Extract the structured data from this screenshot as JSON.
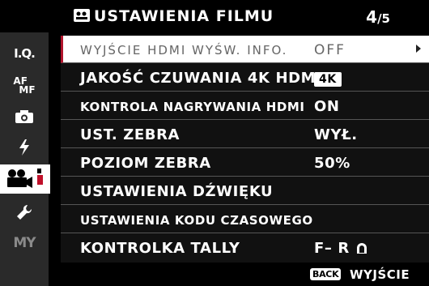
{
  "header": {
    "icon": "movie-camera-icon",
    "title": "USTAWIENIA FILMU",
    "page": "4",
    "page_total": "/5"
  },
  "sidebar": {
    "items": [
      {
        "label": "I.Q.",
        "icon": "image-quality-icon"
      },
      {
        "label_top": "AF",
        "label_bottom": "MF",
        "icon": "af-mf-icon"
      },
      {
        "icon": "camera-icon"
      },
      {
        "icon": "flash-icon"
      },
      {
        "icon": "movie-camera-icon",
        "active": true
      },
      {
        "icon": "wrench-icon"
      },
      {
        "label": "MY",
        "icon": "my-menu-icon"
      }
    ]
  },
  "menu": {
    "rows": [
      {
        "label": "WYJŚCIE HDMI WYŚW. INFO.",
        "value": "OFF",
        "selected": true
      },
      {
        "label": "JAKOŚĆ CZUWANIA 4K HDMI",
        "value": "4K"
      },
      {
        "label": "KONTROLA NAGRYWANIA HDMI",
        "value": "ON"
      },
      {
        "label": "UST. ZEBRA",
        "value": "WYŁ."
      },
      {
        "label": "POZIOM ZEBRA",
        "value": "50%"
      },
      {
        "label": "USTAWIENIA DŹWIĘKU",
        "value": ""
      },
      {
        "label": "USTAWIENIA KODU CZASOWEGO",
        "value": ""
      },
      {
        "label": "KONTROLKA TALLY",
        "value": "F– R"
      }
    ]
  },
  "footer": {
    "back_key": "BACK",
    "back_label": "WYJŚCIE"
  },
  "colors": {
    "selection_accent": "#b0142c",
    "sidebar_bg": "#2a2a2a",
    "selected_row_bg": "#ffffff"
  }
}
